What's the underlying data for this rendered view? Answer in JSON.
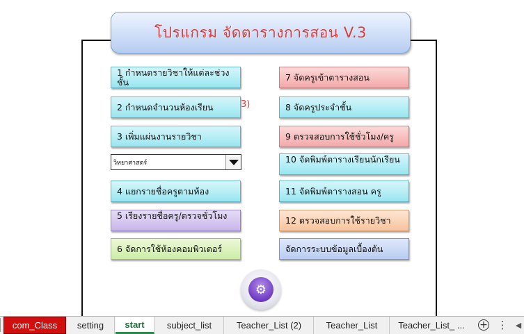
{
  "title": "โปรแกรม จัดตารางการสอน V.3",
  "left_buttons": [
    "1 กำหนดรายวิชาให้แต่ละช่วงชั้น",
    "2 กำหนดจำนวนห้องเรียน",
    "3 เพิ่มแผ่นงานรายวิชา",
    "4 แยกรายชื่อครูตามห้อง",
    "5 เรียงรายชื่อครู/ตรวจชั่วโมง",
    "6 จัดการใช้ห้องคอมพิวเตอร์"
  ],
  "right_buttons": [
    "7 จัดครูเข้าตารางสอน",
    "8 จัดครูประจำชั้น",
    "9 ตรวจสอบการใช้ชั่วโมง/ครู",
    "10 จัดพิมพ์ตารางเรียนนักเรียน",
    "11 จัดพิมพ์ตารางสอน ครู",
    "12 ตรวจสอบการใช้รายวิชา",
    "จัดการระบบข้อมูลเบื้องต้น"
  ],
  "red_fragment": "3)",
  "dropdown_value": "วิทยาศาสตร์",
  "orb_icon": "gears-icon",
  "sheet_tabs": [
    "com_Class",
    "setting",
    "start",
    "subject_list",
    "Teacher_List (2)",
    "Teacher_List",
    "Teacher_List_ ..."
  ],
  "tab_icons": [
    "add-sheet-icon",
    "more-icon",
    "scroll-left-icon"
  ]
}
